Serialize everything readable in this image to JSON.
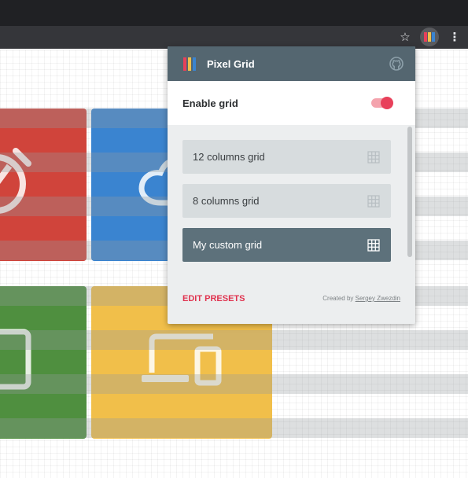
{
  "browser": {
    "toolbar": {
      "star_icon": "star-icon",
      "extension_icon": "pixel-grid-extension-icon",
      "menu_icon": "kebab-menu-icon"
    }
  },
  "popup": {
    "title": "Pixel Grid",
    "github_icon": "github-icon",
    "enable_label": "Enable grid",
    "enable_on": true,
    "presets": [
      {
        "label": "12 columns grid",
        "active": false
      },
      {
        "label": "8 columns grid",
        "active": false
      },
      {
        "label": "My custom grid",
        "active": true
      }
    ],
    "edit_presets": "EDIT PRESETS",
    "credit_prefix": "Created by",
    "credit_author": "Sergey Zwezdin"
  },
  "colors": {
    "header_bg": "#546670",
    "accent": "#e8405a",
    "preset_bg": "#d7dcde",
    "preset_active_bg": "#5d717b",
    "tile_red": "#d0443b",
    "tile_blue": "#3a84d0",
    "tile_green": "#4f8f3f",
    "tile_yellow": "#f1bf4a",
    "logo_colors": [
      "#e8405a",
      "#f1bf4a",
      "#3a84d0"
    ]
  }
}
